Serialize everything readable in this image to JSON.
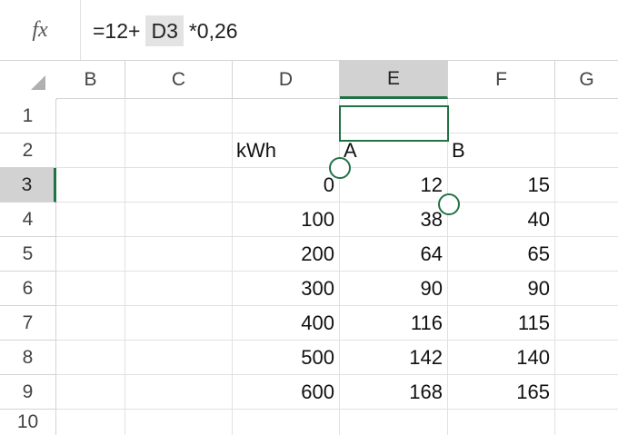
{
  "formula_bar": {
    "fx_label": "fx",
    "prefix": "=12+",
    "reference": "D3",
    "suffix": "*0,26"
  },
  "columns": [
    "B",
    "C",
    "D",
    "E",
    "F",
    "G"
  ],
  "active_column": "E",
  "rows": [
    "1",
    "2",
    "3",
    "4",
    "5",
    "6",
    "7",
    "8",
    "9",
    "10"
  ],
  "active_row": "3",
  "cells": {
    "D2": "kWh",
    "E2": "A",
    "F2": "B",
    "D3": "0",
    "E3": "12",
    "F3": "15",
    "D4": "100",
    "E4": "38",
    "F4": "40",
    "D5": "200",
    "E5": "64",
    "F5": "65",
    "D6": "300",
    "E6": "90",
    "F6": "90",
    "D7": "400",
    "E7": "116",
    "F7": "115",
    "D8": "500",
    "E8": "142",
    "F8": "140",
    "D9": "600",
    "E9": "168",
    "F9": "165"
  },
  "accent_color": "#217346"
}
